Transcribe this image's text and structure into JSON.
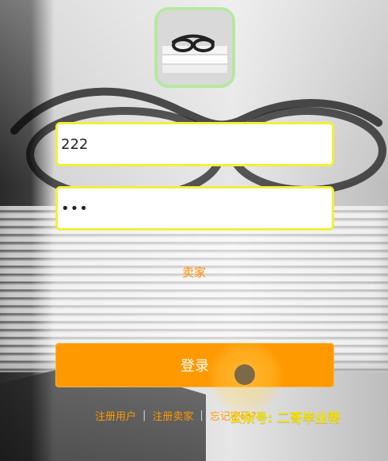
{
  "form": {
    "username_value": "222",
    "password_value": "•••",
    "role_label": "卖家",
    "login_label": "登录"
  },
  "links": {
    "register_user": "注册用户",
    "separator": "|",
    "register_seller": "注册卖家",
    "forgot_password": "忘记密码?"
  },
  "watermark": {
    "text": "公众号: 二哥毕业帮"
  },
  "colors": {
    "accent": "#ff9900",
    "input_border": "#f3ef3a",
    "avatar_border": "#b6e7a2"
  },
  "icons": {
    "avatar": "newspapers-glasses-avatar"
  }
}
